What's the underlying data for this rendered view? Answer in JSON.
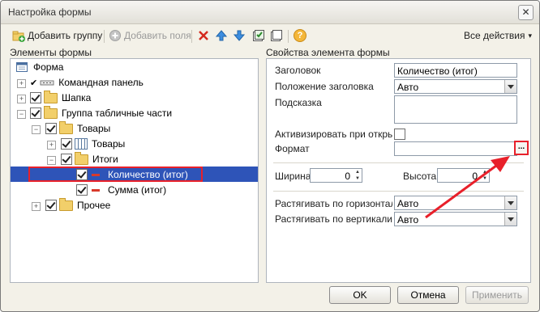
{
  "window": {
    "title": "Настройка формы",
    "close_glyph": "✕"
  },
  "toolbar": {
    "add_group": "Добавить группу",
    "add_fields": "Добавить поля",
    "help_glyph": "?",
    "all_actions": "Все действия",
    "all_actions_arrow": "▾"
  },
  "left": {
    "header": "Элементы формы",
    "tree": [
      {
        "label": "Форма"
      },
      {
        "label": "Командная панель"
      },
      {
        "label": "Шапка"
      },
      {
        "label": "Группа табличные части"
      },
      {
        "label": "Товары"
      },
      {
        "label": "Товары"
      },
      {
        "label": "Итоги"
      },
      {
        "label": "Количество (итог)"
      },
      {
        "label": "Сумма (итог)"
      },
      {
        "label": "Прочее"
      }
    ],
    "expander_plus": "+",
    "expander_minus": "−",
    "checkmark": "✔"
  },
  "right": {
    "header": "Свойства элемента формы",
    "caption_label": "Заголовок",
    "caption_value": "Количество (итог)",
    "caption_pos_label": "Положение заголовка",
    "caption_pos_value": "Авто",
    "tooltip_label": "Подсказка",
    "tooltip_value": "",
    "activate_label": "Активизировать при открыти",
    "format_label": "Формат",
    "format_value": "",
    "format_btn": "...",
    "width_label": "Ширина",
    "width_value": "0",
    "height_label": "Высота",
    "height_value": "0",
    "stretch_h_label": "Растягивать по горизонтали",
    "stretch_h_value": "Авто",
    "stretch_v_label": "Растягивать по вертикали",
    "stretch_v_value": "Авто"
  },
  "footer": {
    "ok": "OK",
    "cancel": "Отмена",
    "apply": "Применить"
  },
  "colors": {
    "selection": "#2e54b8",
    "highlight_box": "#e8202a",
    "arrow": "#e8202a"
  }
}
